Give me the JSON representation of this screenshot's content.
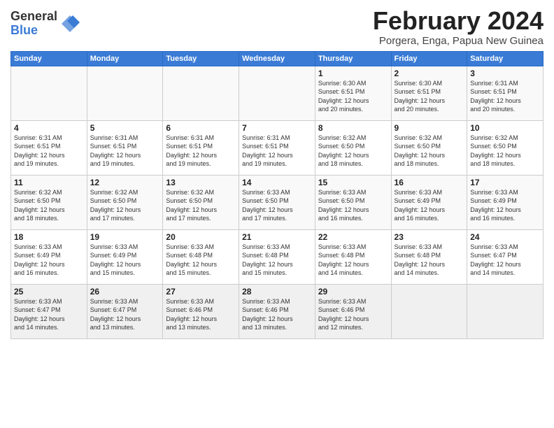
{
  "logo": {
    "general": "General",
    "blue": "Blue"
  },
  "title": "February 2024",
  "subtitle": "Porgera, Enga, Papua New Guinea",
  "days_header": [
    "Sunday",
    "Monday",
    "Tuesday",
    "Wednesday",
    "Thursday",
    "Friday",
    "Saturday"
  ],
  "weeks": [
    [
      {
        "num": "",
        "info": ""
      },
      {
        "num": "",
        "info": ""
      },
      {
        "num": "",
        "info": ""
      },
      {
        "num": "",
        "info": ""
      },
      {
        "num": "1",
        "info": "Sunrise: 6:30 AM\nSunset: 6:51 PM\nDaylight: 12 hours\nand 20 minutes."
      },
      {
        "num": "2",
        "info": "Sunrise: 6:30 AM\nSunset: 6:51 PM\nDaylight: 12 hours\nand 20 minutes."
      },
      {
        "num": "3",
        "info": "Sunrise: 6:31 AM\nSunset: 6:51 PM\nDaylight: 12 hours\nand 20 minutes."
      }
    ],
    [
      {
        "num": "4",
        "info": "Sunrise: 6:31 AM\nSunset: 6:51 PM\nDaylight: 12 hours\nand 19 minutes."
      },
      {
        "num": "5",
        "info": "Sunrise: 6:31 AM\nSunset: 6:51 PM\nDaylight: 12 hours\nand 19 minutes."
      },
      {
        "num": "6",
        "info": "Sunrise: 6:31 AM\nSunset: 6:51 PM\nDaylight: 12 hours\nand 19 minutes."
      },
      {
        "num": "7",
        "info": "Sunrise: 6:31 AM\nSunset: 6:51 PM\nDaylight: 12 hours\nand 19 minutes."
      },
      {
        "num": "8",
        "info": "Sunrise: 6:32 AM\nSunset: 6:50 PM\nDaylight: 12 hours\nand 18 minutes."
      },
      {
        "num": "9",
        "info": "Sunrise: 6:32 AM\nSunset: 6:50 PM\nDaylight: 12 hours\nand 18 minutes."
      },
      {
        "num": "10",
        "info": "Sunrise: 6:32 AM\nSunset: 6:50 PM\nDaylight: 12 hours\nand 18 minutes."
      }
    ],
    [
      {
        "num": "11",
        "info": "Sunrise: 6:32 AM\nSunset: 6:50 PM\nDaylight: 12 hours\nand 18 minutes."
      },
      {
        "num": "12",
        "info": "Sunrise: 6:32 AM\nSunset: 6:50 PM\nDaylight: 12 hours\nand 17 minutes."
      },
      {
        "num": "13",
        "info": "Sunrise: 6:32 AM\nSunset: 6:50 PM\nDaylight: 12 hours\nand 17 minutes."
      },
      {
        "num": "14",
        "info": "Sunrise: 6:33 AM\nSunset: 6:50 PM\nDaylight: 12 hours\nand 17 minutes."
      },
      {
        "num": "15",
        "info": "Sunrise: 6:33 AM\nSunset: 6:50 PM\nDaylight: 12 hours\nand 16 minutes."
      },
      {
        "num": "16",
        "info": "Sunrise: 6:33 AM\nSunset: 6:49 PM\nDaylight: 12 hours\nand 16 minutes."
      },
      {
        "num": "17",
        "info": "Sunrise: 6:33 AM\nSunset: 6:49 PM\nDaylight: 12 hours\nand 16 minutes."
      }
    ],
    [
      {
        "num": "18",
        "info": "Sunrise: 6:33 AM\nSunset: 6:49 PM\nDaylight: 12 hours\nand 16 minutes."
      },
      {
        "num": "19",
        "info": "Sunrise: 6:33 AM\nSunset: 6:49 PM\nDaylight: 12 hours\nand 15 minutes."
      },
      {
        "num": "20",
        "info": "Sunrise: 6:33 AM\nSunset: 6:48 PM\nDaylight: 12 hours\nand 15 minutes."
      },
      {
        "num": "21",
        "info": "Sunrise: 6:33 AM\nSunset: 6:48 PM\nDaylight: 12 hours\nand 15 minutes."
      },
      {
        "num": "22",
        "info": "Sunrise: 6:33 AM\nSunset: 6:48 PM\nDaylight: 12 hours\nand 14 minutes."
      },
      {
        "num": "23",
        "info": "Sunrise: 6:33 AM\nSunset: 6:48 PM\nDaylight: 12 hours\nand 14 minutes."
      },
      {
        "num": "24",
        "info": "Sunrise: 6:33 AM\nSunset: 6:47 PM\nDaylight: 12 hours\nand 14 minutes."
      }
    ],
    [
      {
        "num": "25",
        "info": "Sunrise: 6:33 AM\nSunset: 6:47 PM\nDaylight: 12 hours\nand 14 minutes."
      },
      {
        "num": "26",
        "info": "Sunrise: 6:33 AM\nSunset: 6:47 PM\nDaylight: 12 hours\nand 13 minutes."
      },
      {
        "num": "27",
        "info": "Sunrise: 6:33 AM\nSunset: 6:46 PM\nDaylight: 12 hours\nand 13 minutes."
      },
      {
        "num": "28",
        "info": "Sunrise: 6:33 AM\nSunset: 6:46 PM\nDaylight: 12 hours\nand 13 minutes."
      },
      {
        "num": "29",
        "info": "Sunrise: 6:33 AM\nSunset: 6:46 PM\nDaylight: 12 hours\nand 12 minutes."
      },
      {
        "num": "",
        "info": ""
      },
      {
        "num": "",
        "info": ""
      }
    ]
  ]
}
